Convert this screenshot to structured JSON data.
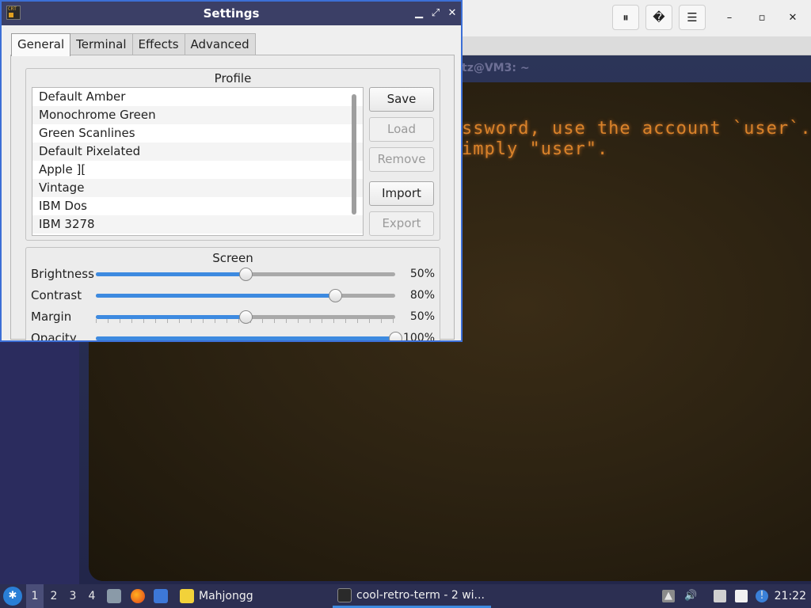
{
  "settings": {
    "title": "Settings",
    "icon_text": "CRT",
    "tabs": [
      "General",
      "Terminal",
      "Effects",
      "Advanced"
    ],
    "active_tab": "General",
    "profile": {
      "title": "Profile",
      "items": [
        "Default Amber",
        "Monochrome Green",
        "Green Scanlines",
        "Default Pixelated",
        "Apple ][",
        "Vintage",
        "IBM Dos",
        "IBM 3278"
      ],
      "buttons": {
        "save": "Save",
        "load": "Load",
        "remove": "Remove",
        "import": "Import",
        "export": "Export"
      }
    },
    "screen": {
      "title": "Screen",
      "sliders": [
        {
          "label": "Brightness",
          "value": 0.5,
          "value_text": "50%"
        },
        {
          "label": "Contrast",
          "value": 0.8,
          "value_text": "80%"
        },
        {
          "label": "Margin",
          "value": 0.5,
          "value_text": "50%"
        },
        {
          "label": "Opacity",
          "value": 1.0,
          "value_text": "100%"
        }
      ]
    }
  },
  "terminal": {
    "tab_title": "tz@VM3: ~",
    "lines": [
      "ssword, use the account `user`.",
      "imply \"user\"."
    ],
    "text_color": "#d9822a"
  },
  "taskbar": {
    "workspaces": [
      "1",
      "2",
      "3",
      "4"
    ],
    "active_workspace": "1",
    "tasks": [
      "Mahjongg",
      "cool-retro-term - 2 wi..."
    ],
    "clock": "21:22"
  },
  "colors": {
    "accent": "#3d8ae0",
    "dialog_titlebar": "#3b3f66",
    "taskbar": "#2c2f52"
  }
}
